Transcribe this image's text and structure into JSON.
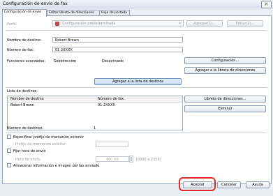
{
  "window": {
    "title": "Configuración de envío de fax",
    "close_label": "×"
  },
  "tabs": [
    {
      "label": "Configuración de envío"
    },
    {
      "label": "Editar libreta de direcciones"
    },
    {
      "label": "Hoja de portada"
    }
  ],
  "preset": {
    "label": "Perfil:",
    "value": "Configuración predeterminada",
    "add_label": "Agregar(1)...",
    "edit_label": "Editar(2)..."
  },
  "destination": {
    "name_label": "Nombre de destino:",
    "name_value": "Robert Brown",
    "fax_label": "Número de fax:",
    "fax_value": "01 2XXXX"
  },
  "advanced": {
    "label": "Funciones avanzadas:",
    "sub_label": "Subdirección",
    "sub_value": "Desactivado",
    "config_button": "Configuración...",
    "add_to_book_button": "Agregar a la libreta de direcciones",
    "add_to_list_button": "Agregar a la lista de destinos"
  },
  "dest_list": {
    "label": "Lista de destinos:",
    "columns": [
      "Nombre de destino",
      "Número de fax"
    ],
    "rows": [
      [
        "Robert Brown",
        "01 2XXXX"
      ]
    ],
    "book_button": "Libreta de direcciones...",
    "delete_button": "Eliminar",
    "count_label": "Número de destinos:",
    "count_value": "1"
  },
  "options": {
    "prefix_check": "Especificar prefijo de marcación exterior",
    "prefix_label": "Prefijo de marcación exterior:",
    "time_check": "Fijar hora de envío",
    "time_label": "Hora de envío:",
    "time_value": "00 : 00",
    "time_hint": "[0000 a 2359]",
    "store_check": "Almacenar información e imagen del fax enviado"
  },
  "footer": {
    "accept": "Aceptar",
    "cancel": "Cancelar",
    "help": "Ayuda"
  },
  "colors": {
    "highlight": "#e02a2a",
    "accent": "#6e8fbb"
  }
}
